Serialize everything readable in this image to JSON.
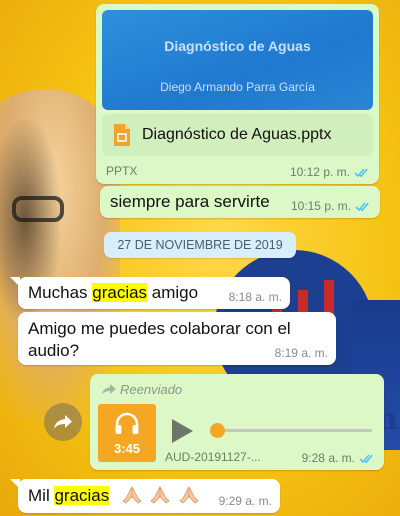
{
  "file_message": {
    "preview_title": "Diagnóstico de Aguas",
    "preview_author": "Diego Armando Parra García",
    "file_name": "Diagnóstico de Aguas.pptx",
    "file_type": "PPTX",
    "time": "10:12 p. m."
  },
  "msg_siempre": {
    "text": "siempre para servirte",
    "time": "10:15 p. m."
  },
  "date_divider": "27 DE NOVIEMBRE DE 2019",
  "msg_gracias": {
    "pre": "Muchas ",
    "highlight": "gracias",
    "post": " amigo",
    "time": "8:18 a. m."
  },
  "msg_colabora": {
    "line1": "Amigo me puedes colaborar con el",
    "line2": "audio?",
    "time": "8:19 a. m."
  },
  "audio_message": {
    "forwarded_label": "Reenviado",
    "duration": "3:45",
    "file_name": "AUD-20191127-...",
    "time": "9:28 a. m."
  },
  "msg_mil": {
    "pre": "Mil ",
    "highlight": "gracias",
    "time": "9:29 a. m."
  },
  "colors": {
    "outgoing": "#dcf8c6",
    "incoming": "#ffffff",
    "read_ticks": "#4fc3f7",
    "accent": "#f5a623"
  }
}
